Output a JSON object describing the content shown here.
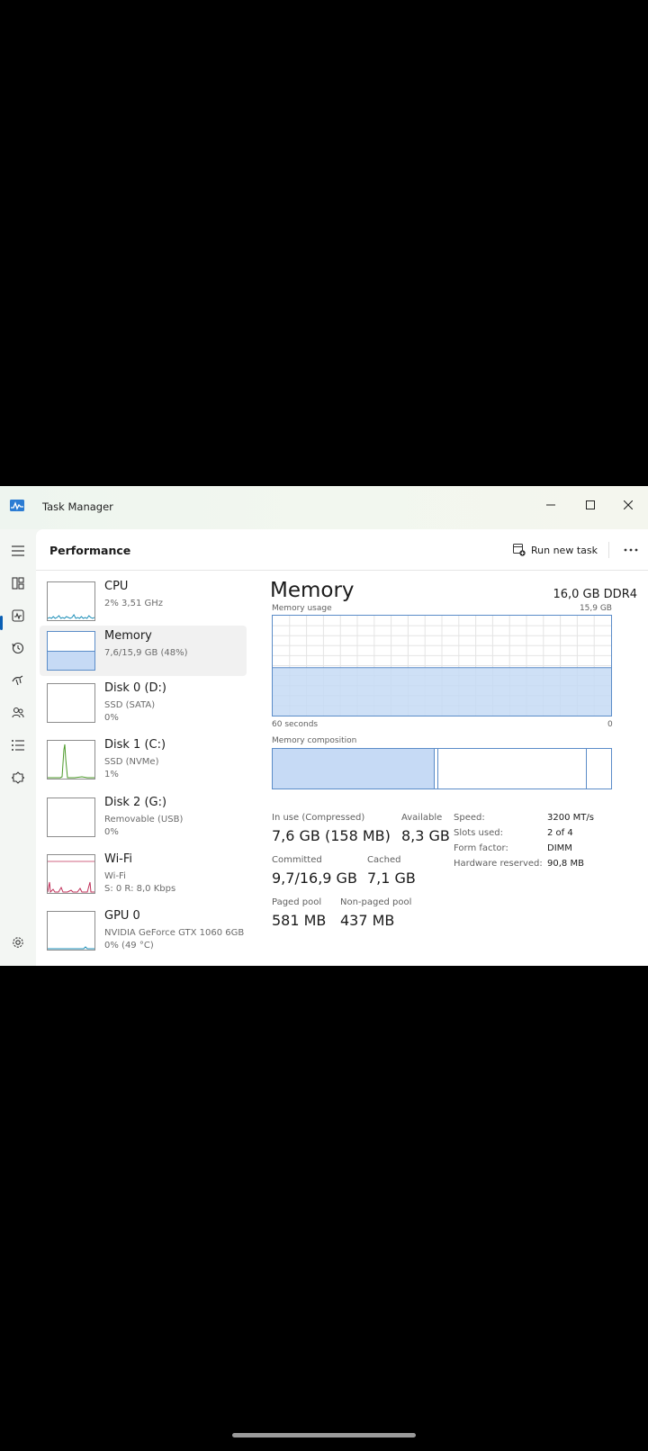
{
  "window": {
    "title": "Task Manager",
    "controls": [
      "minimize-icon",
      "maximize-icon",
      "close-icon"
    ]
  },
  "nav": {
    "icons": [
      "hamburger-menu-icon",
      "processes-icon",
      "performance-icon",
      "app-history-icon",
      "startup-apps-icon",
      "users-icon",
      "details-icon",
      "services-icon",
      "settings-icon"
    ],
    "active": "performance-icon"
  },
  "header": {
    "title": "Performance",
    "run_task_label": "Run new task",
    "more_icon": "more-options-icon"
  },
  "sidebar": {
    "items": [
      {
        "name": "CPU",
        "line1": "2% 3,51 GHz",
        "line2": ""
      },
      {
        "name": "Memory",
        "line1": "7,6/15,9 GB (48%)",
        "line2": ""
      },
      {
        "name": "Disk 0 (D:)",
        "line1": "SSD (SATA)",
        "line2": "0%"
      },
      {
        "name": "Disk 1 (C:)",
        "line1": "SSD (NVMe)",
        "line2": "1%"
      },
      {
        "name": "Disk 2 (G:)",
        "line1": "Removable (USB)",
        "line2": "0%"
      },
      {
        "name": "Wi-Fi",
        "line1": "Wi-Fi",
        "line2": "S: 0 R: 8,0 Kbps"
      },
      {
        "name": "GPU 0",
        "line1": "NVIDIA GeForce GTX 1060 6GB",
        "line2": "0% (49 °C)"
      }
    ],
    "selected_index": 1,
    "memory_thumb_fill": 0.48
  },
  "main": {
    "title": "Memory",
    "spec": "16,0 GB DDR4",
    "usage_label": "Memory usage",
    "usage_max": "15,9 GB",
    "time_left": "60 seconds",
    "time_right": "0",
    "usage_fraction": 0.48,
    "composition_label": "Memory composition",
    "composition": {
      "in_use_fraction": 0.48,
      "modified_fraction": 0.01,
      "standby_fraction": 0.44,
      "free_fraction": 0.07
    },
    "stats": {
      "in_use_label": "In use (Compressed)",
      "in_use_value": "7,6 GB (158 MB)",
      "available_label": "Available",
      "available_value": "8,3 GB",
      "committed_label": "Committed",
      "committed_value": "9,7/16,9 GB",
      "cached_label": "Cached",
      "cached_value": "7,1 GB",
      "paged_label": "Paged pool",
      "paged_value": "581 MB",
      "nonpaged_label": "Non-paged pool",
      "nonpaged_value": "437 MB"
    },
    "specs": [
      {
        "label": "Speed:",
        "value": "3200 MT/s"
      },
      {
        "label": "Slots used:",
        "value": "2 of 4"
      },
      {
        "label": "Form factor:",
        "value": "DIMM"
      },
      {
        "label": "Hardware reserved:",
        "value": "90,8 MB"
      }
    ]
  },
  "colors": {
    "accent": "#0a5fb4",
    "memory_fill": "#c6daf5",
    "memory_line": "#5b8cc8",
    "cpu_line": "#1d8fb8",
    "disk_line": "#4c9a2a",
    "wifi_line": "#c0305a"
  }
}
